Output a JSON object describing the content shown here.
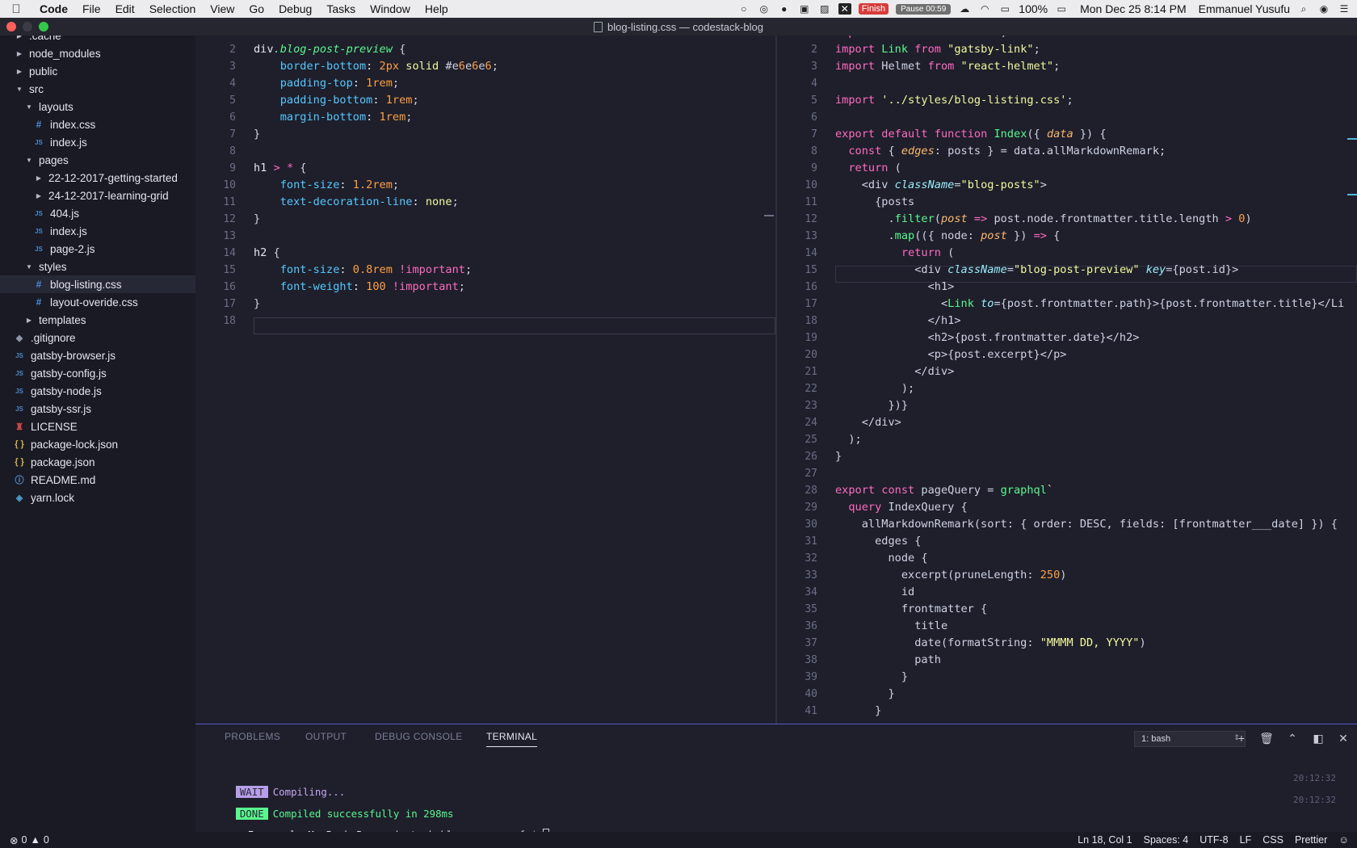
{
  "menubar": {
    "items": [
      "Code",
      "File",
      "Edit",
      "Selection",
      "View",
      "Go",
      "Debug",
      "Tasks",
      "Window",
      "Help"
    ],
    "finish_label": "Finish",
    "pause_label": "Pause 00:59",
    "battery": "100%",
    "datetime": "Mon Dec 25  8:14 PM",
    "user": "Emmanuel Yusufu"
  },
  "window": {
    "title": "blog-listing.css — codestack-blog"
  },
  "sidebar": {
    "items": [
      {
        "label": ".cache",
        "indent": 0,
        "twisty": "right",
        "icon": ""
      },
      {
        "label": "node_modules",
        "indent": 0,
        "twisty": "right",
        "icon": ""
      },
      {
        "label": "public",
        "indent": 0,
        "twisty": "right",
        "icon": ""
      },
      {
        "label": "src",
        "indent": 0,
        "twisty": "down",
        "icon": ""
      },
      {
        "label": "layouts",
        "indent": 1,
        "twisty": "down",
        "icon": ""
      },
      {
        "label": "index.css",
        "indent": 2,
        "twisty": "",
        "icon": "css"
      },
      {
        "label": "index.js",
        "indent": 2,
        "twisty": "",
        "icon": "js"
      },
      {
        "label": "pages",
        "indent": 1,
        "twisty": "down",
        "icon": ""
      },
      {
        "label": "22-12-2017-getting-started",
        "indent": 2,
        "twisty": "right",
        "icon": ""
      },
      {
        "label": "24-12-2017-learning-grid",
        "indent": 2,
        "twisty": "right",
        "icon": ""
      },
      {
        "label": "404.js",
        "indent": 2,
        "twisty": "",
        "icon": "js"
      },
      {
        "label": "index.js",
        "indent": 2,
        "twisty": "",
        "icon": "js"
      },
      {
        "label": "page-2.js",
        "indent": 2,
        "twisty": "",
        "icon": "js"
      },
      {
        "label": "styles",
        "indent": 1,
        "twisty": "down",
        "icon": ""
      },
      {
        "label": "blog-listing.css",
        "indent": 2,
        "twisty": "",
        "icon": "css",
        "selected": true
      },
      {
        "label": "layout-overide.css",
        "indent": 2,
        "twisty": "",
        "icon": "css"
      },
      {
        "label": "templates",
        "indent": 1,
        "twisty": "right",
        "icon": ""
      },
      {
        "label": ".gitignore",
        "indent": 0,
        "twisty": "",
        "icon": "git"
      },
      {
        "label": "gatsby-browser.js",
        "indent": 0,
        "twisty": "",
        "icon": "js"
      },
      {
        "label": "gatsby-config.js",
        "indent": 0,
        "twisty": "",
        "icon": "js"
      },
      {
        "label": "gatsby-node.js",
        "indent": 0,
        "twisty": "",
        "icon": "js"
      },
      {
        "label": "gatsby-ssr.js",
        "indent": 0,
        "twisty": "",
        "icon": "js"
      },
      {
        "label": "LICENSE",
        "indent": 0,
        "twisty": "",
        "icon": "lic"
      },
      {
        "label": "package-lock.json",
        "indent": 0,
        "twisty": "",
        "icon": "json"
      },
      {
        "label": "package.json",
        "indent": 0,
        "twisty": "",
        "icon": "json"
      },
      {
        "label": "README.md",
        "indent": 0,
        "twisty": "",
        "icon": "info"
      },
      {
        "label": "yarn.lock",
        "indent": 0,
        "twisty": "",
        "icon": "yarn"
      }
    ]
  },
  "editor_left": {
    "file": "blog-listing.css",
    "lines": [
      "",
      "div.blog-post-preview {",
      "    border-bottom: 2px solid #e6e6e6;",
      "    padding-top: 1rem;",
      "    padding-bottom: 1rem;",
      "    margin-bottom: 1rem;",
      "}",
      "",
      "h1 > * {",
      "    font-size: 1.2rem;",
      "    text-decoration-line: none;",
      "}",
      "",
      "h2 {",
      "    font-size: 0.8rem !important;",
      "    font-weight: 100 !important;",
      "}",
      ""
    ]
  },
  "editor_right": {
    "file": "index.js",
    "lines": [
      "import React from \"react\";",
      "import Link from \"gatsby-link\";",
      "import Helmet from \"react-helmet\";",
      "",
      "import '../styles/blog-listing.css';",
      "",
      "export default function Index({ data }) {",
      "  const { edges: posts } = data.allMarkdownRemark;",
      "  return (",
      "    <div className=\"blog-posts\">",
      "      {posts",
      "        .filter(post => post.node.frontmatter.title.length > 0)",
      "        .map(({ node: post }) => {",
      "          return (",
      "            <div className=\"blog-post-preview\" key={post.id}>",
      "              <h1>",
      "                <Link to={post.frontmatter.path}>{post.frontmatter.title}</Li",
      "              </h1>",
      "              <h2>{post.frontmatter.date}</h2>",
      "              <p>{post.excerpt}</p>",
      "            </div>",
      "          );",
      "        })}",
      "    </div>",
      "  );",
      "}",
      "",
      "export const pageQuery = graphql`",
      "  query IndexQuery {",
      "    allMarkdownRemark(sort: { order: DESC, fields: [frontmatter___date] }) {",
      "      edges {",
      "        node {",
      "          excerpt(pruneLength: 250)",
      "          id",
      "          frontmatter {",
      "            title",
      "            date(formatString: \"MMMM DD, YYYY\")",
      "            path",
      "          }",
      "        }",
      "      }"
    ]
  },
  "panel": {
    "tabs": [
      "PROBLEMS",
      "OUTPUT",
      "DEBUG CONSOLE",
      "TERMINAL"
    ],
    "active_tab": "TERMINAL",
    "terminal_select": "1: bash",
    "terminal": [
      {
        "badge": "WAIT",
        "text": "Compiling...",
        "time": "20:12:32"
      },
      {
        "badge": "DONE",
        "text": "Compiled successfully in 298ms",
        "time": "20:12:32"
      }
    ],
    "prompt": "> Emmanuels-MacBook-Pro:codestack-blog emmyyusufu$ "
  },
  "statusbar": {
    "errors": "0",
    "warnings": "0",
    "position": "Ln 18, Col 1",
    "spaces": "Spaces: 4",
    "encoding": "UTF-8",
    "eol": "LF",
    "language": "CSS",
    "formatter": "Prettier"
  },
  "colors": {
    "accent": "#5a5cc8",
    "background": "#1e1f2b",
    "sidebar": "#191a23"
  }
}
